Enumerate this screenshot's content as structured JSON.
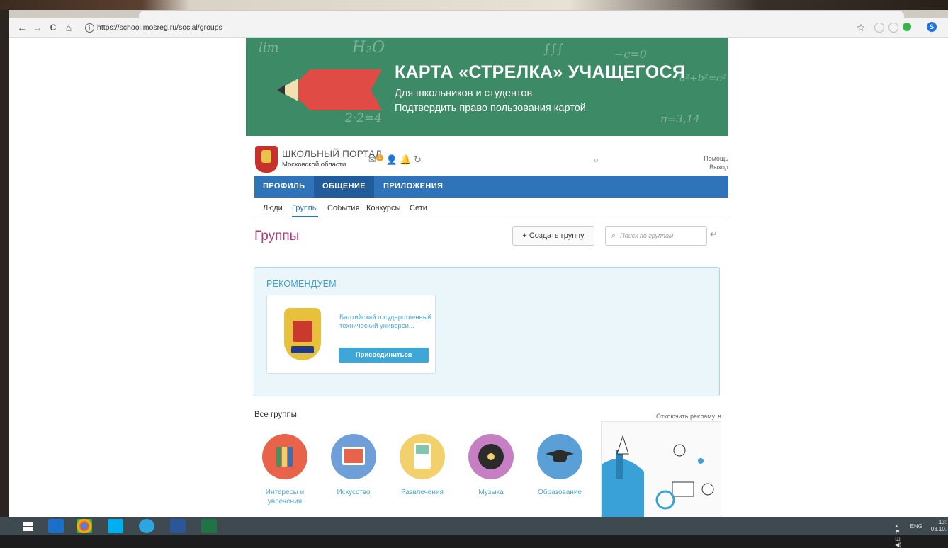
{
  "browser": {
    "url": "https://school.mosreg.ru/social/groups",
    "nav_back": "←",
    "nav_forward": "→",
    "nav_reload": "C",
    "nav_home": "⌂",
    "star": "☆",
    "profile_letter": "S"
  },
  "banner": {
    "title": "КАРТА «СТРЕЛКА» УЧАЩЕГОСЯ",
    "subtitle_1": "Для школьников и студентов",
    "subtitle_2": "Подтвердить право пользования картой"
  },
  "portal": {
    "title": "ШКОЛЬНЫЙ ПОРТАЛ",
    "subtitle": "Московской области",
    "badge_count": "1",
    "help_link": "Помощь",
    "logout_link": "Выход"
  },
  "nav_main": [
    {
      "label": "ПРОФИЛЬ",
      "active": false
    },
    {
      "label": "ОБЩЕНИЕ",
      "active": true
    },
    {
      "label": "ПРИЛОЖЕНИЯ",
      "active": false
    }
  ],
  "nav_sub": [
    {
      "label": "Люди",
      "active": false
    },
    {
      "label": "Группы",
      "active": true
    },
    {
      "label": "События",
      "active": false
    },
    {
      "label": "Конкурсы",
      "active": false
    },
    {
      "label": "Сети",
      "active": false
    }
  ],
  "page": {
    "title": "Группы",
    "create_button": "+ Создать группу",
    "search_placeholder": "Поиск по группам"
  },
  "recommend": {
    "title": "РЕКОМЕНДУЕМ",
    "card": {
      "name": "Балтийский государственный технический универси...",
      "join_button": "Присоединиться"
    }
  },
  "groups": {
    "title": "Все группы",
    "disable_ads": "Отключить рекламу ✕",
    "categories": [
      {
        "label": "Интересы и увлечения",
        "color": "#e8634a"
      },
      {
        "label": "Искусство",
        "color": "#6f9fd8"
      },
      {
        "label": "Развлечения",
        "color": "#f2d06b"
      },
      {
        "label": "Музыка",
        "color": "#c77fc4"
      },
      {
        "label": "Образование",
        "color": "#5a9fd6"
      }
    ]
  },
  "taskbar": {
    "lang": "ENG",
    "time": "13:",
    "date": "03.10."
  }
}
